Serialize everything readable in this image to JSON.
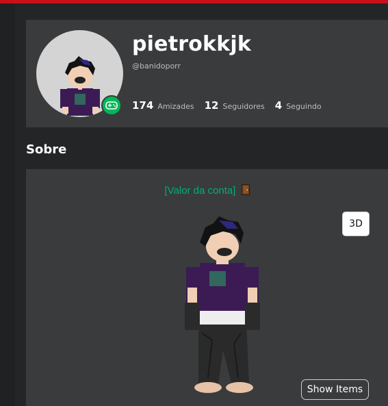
{
  "profile": {
    "display_name": "pietrokkjk",
    "handle": "@banidoporr",
    "stats": [
      {
        "count": "174",
        "label": "Amizades"
      },
      {
        "count": "12",
        "label": "Seguidores"
      },
      {
        "count": "4",
        "label": "Seguindo"
      }
    ],
    "presence_icon": "gamepad-icon"
  },
  "about": {
    "title": "Sobre",
    "account_value_text": "[Valor da conta]",
    "account_value_icon": "door-icon",
    "toggle_3d_label": "3D",
    "show_items_label": "Show Items"
  },
  "colors": {
    "accent_red": "#c8101b",
    "online_green": "#02b757",
    "text_green": "#00b06f"
  }
}
